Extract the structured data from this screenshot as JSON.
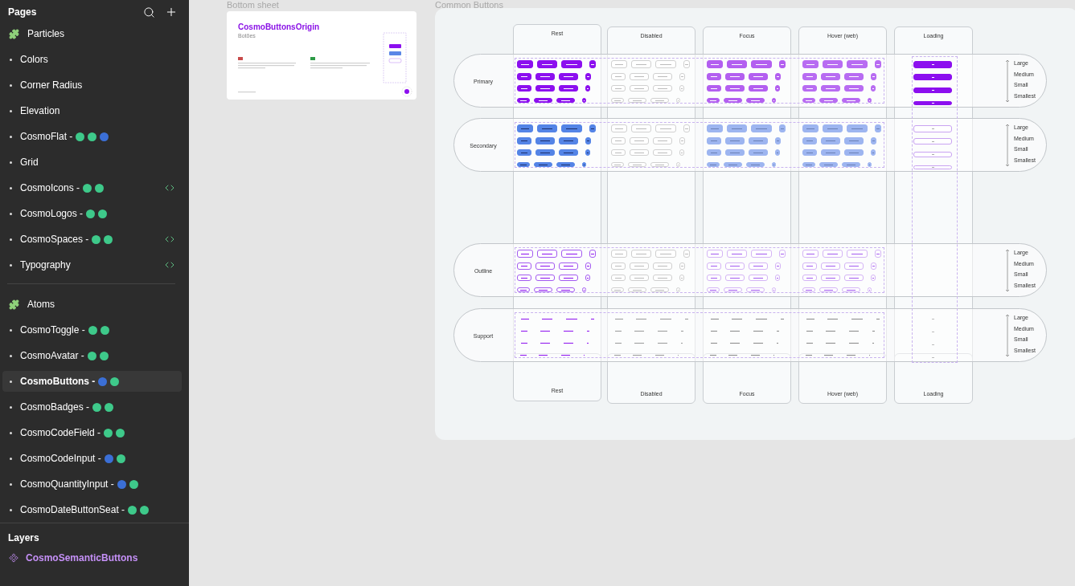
{
  "sidebar": {
    "pages_title": "Pages",
    "groups": [
      {
        "title": "Particles",
        "items": [
          {
            "label": "Colors",
            "code": false,
            "selected": false
          },
          {
            "label": "Corner Radius",
            "code": false,
            "selected": false
          },
          {
            "label": "Elevation",
            "code": false,
            "selected": false
          },
          {
            "label": "CosmoFlat -",
            "dots": [
              {
                "color": "#3ec98a"
              },
              {
                "color": "#3ec98a"
              },
              {
                "color": "#3b6fd6"
              }
            ],
            "code": false,
            "selected": false
          },
          {
            "label": "Grid",
            "code": false,
            "selected": false
          },
          {
            "label": "CosmoIcons -",
            "dots": [
              {
                "color": "#3ec98a"
              },
              {
                "color": "#3ec98a"
              }
            ],
            "code": true,
            "selected": false
          },
          {
            "label": "CosmoLogos -",
            "dots": [
              {
                "color": "#3ec98a"
              },
              {
                "color": "#3ec98a"
              }
            ],
            "code": false,
            "selected": false
          },
          {
            "label": "CosmoSpaces -",
            "dots": [
              {
                "color": "#3ec98a"
              },
              {
                "color": "#3ec98a"
              }
            ],
            "code": true,
            "selected": false
          },
          {
            "label": "Typography",
            "code": true,
            "selected": false
          }
        ]
      },
      {
        "title": "Atoms",
        "items": [
          {
            "label": "CosmoToggle -",
            "dots": [
              {
                "color": "#3ec98a"
              },
              {
                "color": "#3ec98a"
              }
            ],
            "code": false,
            "selected": false
          },
          {
            "label": "CosmoAvatar -",
            "dots": [
              {
                "color": "#3ec98a"
              },
              {
                "color": "#3ec98a"
              }
            ],
            "code": false,
            "selected": false
          },
          {
            "label": "CosmoButtons -",
            "dots": [
              {
                "color": "#3b6fd6"
              },
              {
                "color": "#3ec98a"
              }
            ],
            "code": false,
            "selected": true
          },
          {
            "label": "CosmoBadges -",
            "dots": [
              {
                "color": "#3ec98a"
              },
              {
                "color": "#3ec98a"
              }
            ],
            "code": false,
            "selected": false
          },
          {
            "label": "CosmoCodeField -",
            "dots": [
              {
                "color": "#3ec98a"
              },
              {
                "color": "#3ec98a"
              }
            ],
            "code": false,
            "selected": false
          },
          {
            "label": "CosmoCodeInput -",
            "dots": [
              {
                "color": "#3b6fd6"
              },
              {
                "color": "#3ec98a"
              }
            ],
            "code": false,
            "selected": false
          },
          {
            "label": "CosmoQuantityInput -",
            "dots": [
              {
                "color": "#3b6fd6"
              },
              {
                "color": "#3ec98a"
              }
            ],
            "code": false,
            "selected": false
          },
          {
            "label": "CosmoDateButtonSeat -",
            "dots": [
              {
                "color": "#3ec98a"
              },
              {
                "color": "#3ec98a"
              }
            ],
            "code": false,
            "selected": false
          }
        ]
      }
    ],
    "layers_title": "Layers",
    "layers": [
      {
        "label": "CosmoSemanticButtons"
      }
    ]
  },
  "cover": {
    "frame_label": "Bottom sheet",
    "title": "CosmoButtonsOrigin",
    "subtitle": "Botões"
  },
  "board": {
    "frame_label": "Common Buttons",
    "columns": [
      {
        "label": "Rest",
        "kind": "rest"
      },
      {
        "label": "Disabled",
        "kind": "disabled"
      },
      {
        "label": "Focus",
        "kind": "focus"
      },
      {
        "label": "Hover (web)",
        "kind": "hover"
      },
      {
        "label": "Loading",
        "kind": "loading"
      }
    ],
    "footer_labels": [
      "Rest",
      "Disabled",
      "Focus",
      "Hover (web)",
      "Loading"
    ],
    "sections": [
      {
        "label": "Primary",
        "kind": "primary",
        "sizes": [
          "Large",
          "Medium",
          "Small",
          "Smallest"
        ]
      },
      {
        "label": "Secondary",
        "kind": "secondary",
        "sizes": [
          "Large",
          "Medium",
          "Small",
          "Smallest"
        ]
      },
      {
        "label": "Outline",
        "kind": "outline",
        "sizes": [
          "Large",
          "Medium",
          "Small",
          "Smallest"
        ]
      },
      {
        "label": "Support",
        "kind": "support",
        "sizes": [
          "Large",
          "Medium",
          "Small",
          "Smallest"
        ]
      }
    ]
  }
}
